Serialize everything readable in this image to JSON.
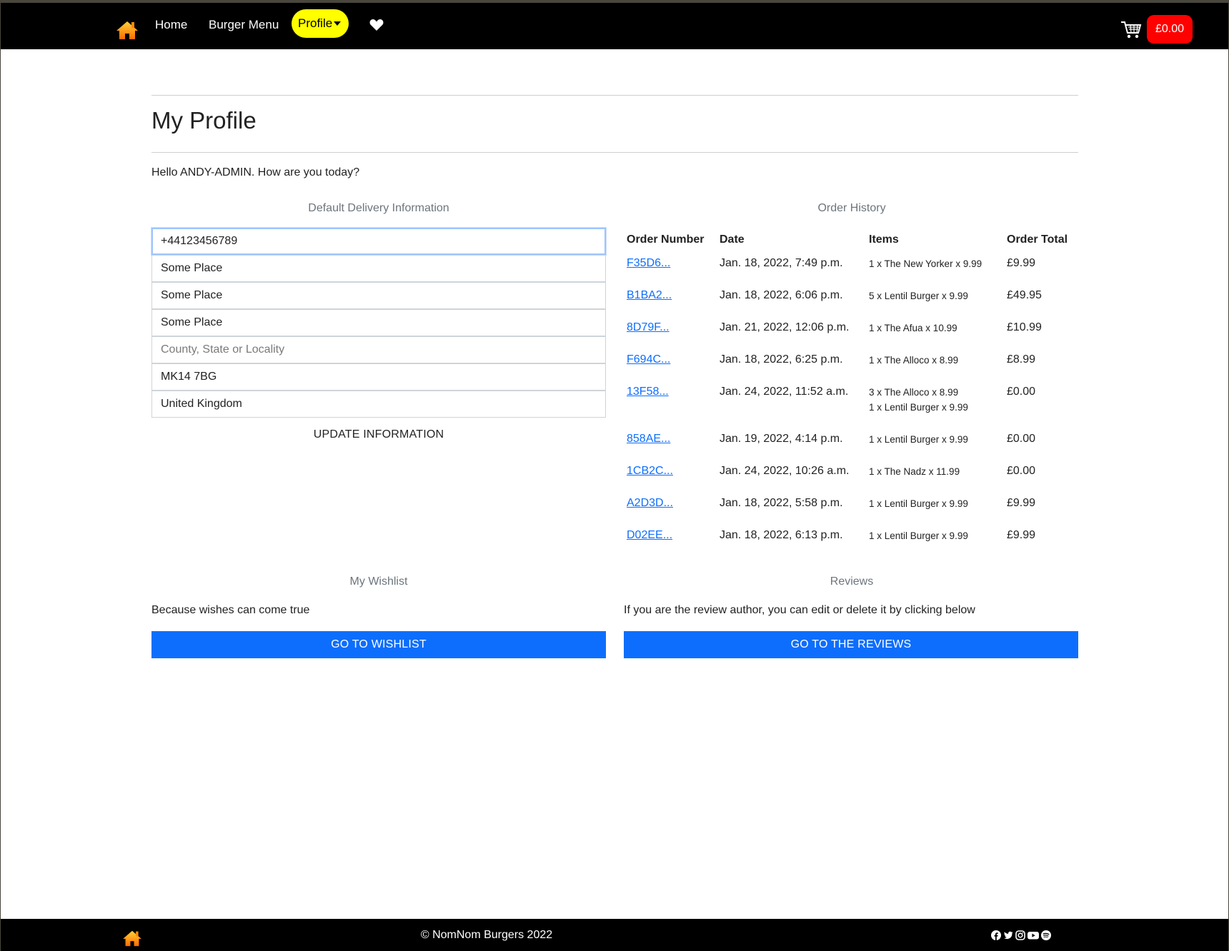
{
  "nav": {
    "home_label": "Home",
    "burger_menu_label": "Burger Menu",
    "profile_label": "Profile",
    "cart_total": "£0.00",
    "colors": {
      "profile_bg": "#ffff00",
      "cart_bg": "#ff0000",
      "bar": "#000000"
    }
  },
  "page": {
    "title": "My Profile",
    "greeting": "Hello ANDY-ADMIN. How are you today?"
  },
  "delivery": {
    "heading": "Default Delivery Information",
    "fields": {
      "phone": "+44123456789",
      "street1": "Some Place",
      "street2": "Some Place",
      "town": "Some Place",
      "county_placeholder": "County, State or Locality",
      "county": "",
      "postcode": "MK14 7BG",
      "country": "United Kingdom"
    },
    "update_label": "UPDATE INFORMATION"
  },
  "orders": {
    "heading": "Order History",
    "columns": [
      "Order Number",
      "Date",
      "Items",
      "Order Total"
    ],
    "rows": [
      {
        "number": "F35D6...",
        "date": "Jan. 18, 2022, 7:49 p.m.",
        "items": [
          "1 x The New Yorker x 9.99"
        ],
        "total": "£9.99"
      },
      {
        "number": "B1BA2...",
        "date": "Jan. 18, 2022, 6:06 p.m.",
        "items": [
          "5 x Lentil Burger x 9.99"
        ],
        "total": "£49.95"
      },
      {
        "number": "8D79F...",
        "date": "Jan. 21, 2022, 12:06 p.m.",
        "items": [
          "1 x The Afua x 10.99"
        ],
        "total": "£10.99"
      },
      {
        "number": "F694C...",
        "date": "Jan. 18, 2022, 6:25 p.m.",
        "items": [
          "1 x The Alloco x 8.99"
        ],
        "total": "£8.99"
      },
      {
        "number": "13F58...",
        "date": "Jan. 24, 2022, 11:52 a.m.",
        "items": [
          "3 x The Alloco x 8.99",
          "1 x Lentil Burger x 9.99"
        ],
        "total": "£0.00"
      },
      {
        "number": "858AE...",
        "date": "Jan. 19, 2022, 4:14 p.m.",
        "items": [
          "1 x Lentil Burger x 9.99"
        ],
        "total": "£0.00"
      },
      {
        "number": "1CB2C...",
        "date": "Jan. 24, 2022, 10:26 a.m.",
        "items": [
          "1 x The Nadz x 11.99"
        ],
        "total": "£0.00"
      },
      {
        "number": "A2D3D...",
        "date": "Jan. 18, 2022, 5:58 p.m.",
        "items": [
          "1 x Lentil Burger x 9.99"
        ],
        "total": "£9.99"
      },
      {
        "number": "D02EE...",
        "date": "Jan. 18, 2022, 6:13 p.m.",
        "items": [
          "1 x Lentil Burger x 9.99"
        ],
        "total": "£9.99"
      }
    ]
  },
  "wishlist": {
    "heading": "My Wishlist",
    "text": "Because wishes can come true",
    "button": "GO TO WISHLIST"
  },
  "reviews": {
    "heading": "Reviews",
    "text": "If you are the review author, you can edit or delete it by clicking below",
    "button": "GO TO THE REVIEWS"
  },
  "footer": {
    "copyright": "© NomNom Burgers 2022",
    "social_icons": [
      "facebook-icon",
      "twitter-icon",
      "instagram-icon",
      "youtube-icon",
      "spotify-icon"
    ]
  }
}
